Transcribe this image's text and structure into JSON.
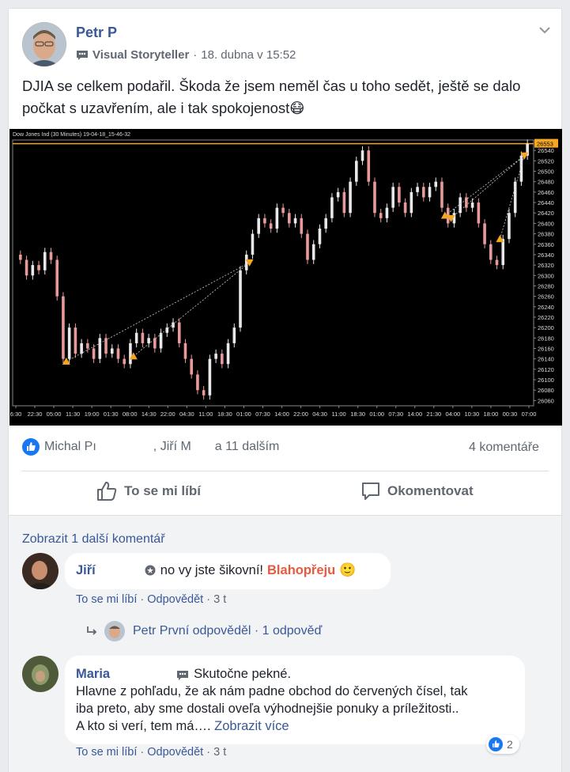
{
  "post": {
    "author": "Petr P",
    "subtitle_role": "Visual Storyteller",
    "subtitle_sep": "·",
    "time": "18. dubna v 15:52",
    "text": "DJIA se celkem podařil. Škoda že jsem neměl čas u toho sedět, ještě se dalo počkat s uzavřením, ale i tak spokojenost😷"
  },
  "chart_data": {
    "type": "candlestick",
    "title": "Dow Jones Ind (30 Minutes) 19-04-18_15-46-32",
    "last_price_label": "26553",
    "y_ticks": [
      "26540",
      "26520",
      "26500",
      "26480",
      "26460",
      "26440",
      "26420",
      "26400",
      "26380",
      "26360",
      "26340",
      "26320",
      "26300",
      "26280",
      "26260",
      "26240",
      "26220",
      "26200",
      "26180",
      "26160",
      "26140",
      "26120",
      "26100",
      "26080",
      "26060"
    ],
    "x_ticks": [
      "6:30",
      "22:30",
      "05:00",
      "11:30",
      "19:00",
      "01:30",
      "08:00",
      "14:30",
      "22:00",
      "04:30",
      "11:00",
      "18:30",
      "01:00",
      "07:30",
      "14:00",
      "22:00",
      "04:30",
      "11:00",
      "18:30",
      "01:00",
      "07:30",
      "14:00",
      "21:30",
      "04:00",
      "10:30",
      "18:00",
      "00:30",
      "07:00"
    ],
    "ylim": [
      26050,
      26560
    ],
    "price_path": [
      26340,
      26330,
      26300,
      26320,
      26310,
      26345,
      26330,
      26260,
      26140,
      26200,
      26150,
      26170,
      26160,
      26140,
      26180,
      26150,
      26160,
      26140,
      26130,
      26170,
      26190,
      26170,
      26180,
      26160,
      26190,
      26200,
      26210,
      26170,
      26140,
      26110,
      26080,
      26070,
      26140,
      26150,
      26130,
      26170,
      26200,
      26310,
      26340,
      26380,
      26410,
      26400,
      26390,
      26430,
      26420,
      26400,
      26410,
      26380,
      26330,
      26360,
      26390,
      26410,
      26450,
      26460,
      26420,
      26480,
      26520,
      26540,
      26480,
      26420,
      26410,
      26430,
      26470,
      26440,
      26420,
      26460,
      26470,
      26450,
      26470,
      26480,
      26430,
      26400,
      26420,
      26450,
      26430,
      26440,
      26400,
      26360,
      26330,
      26320,
      26370,
      26420,
      26480,
      26530,
      26553
    ],
    "trade_markers": [
      {
        "i": 8,
        "price": 26135,
        "dir": "buy"
      },
      {
        "i": 19,
        "price": 26145,
        "dir": "buy"
      },
      {
        "i": 38,
        "price": 26325,
        "dir": "sell"
      },
      {
        "i": 70,
        "price": 26415,
        "dir": "buy"
      },
      {
        "i": 71,
        "price": 26410,
        "dir": "sell"
      },
      {
        "i": 79,
        "price": 26370,
        "dir": "buy"
      },
      {
        "i": 83,
        "price": 26530,
        "dir": "sell"
      }
    ],
    "colors": {
      "up": "#e8e8e8",
      "down": "#e89a9a",
      "marker": "#f5a623",
      "price_line": "#f5a623"
    }
  },
  "reactions": {
    "names_a": "Michal Pı",
    "names_b": ", Jiří M",
    "names_c": "a 11 dalším",
    "comments_count": "4 komentáře"
  },
  "actions": {
    "like": "To se mi líbí",
    "comment": "Okomentovat"
  },
  "comments": {
    "more": "Zobrazit 1 další komentář",
    "c1": {
      "author": "Jiří",
      "text": "no vy jste šikovní!",
      "highlight": "Blahopřeju",
      "emoji": "🙂",
      "like": "To se mi líbí",
      "reply": "Odpovědět",
      "time": "3 t",
      "reply_summary": "Petr První odpověděl · 1 odpověď"
    },
    "c2": {
      "author": "Maria",
      "line1": "Skutočne pekné.",
      "line2": "Hlavne z pohľadu, že ak nám padne obchod do červených čísel, tak",
      "line3": "iba preto, aby sme dostali oveľa výhodnejšie ponuky a príležitosti..",
      "line4": "A kto si verí, tem má….",
      "see_more": "Zobrazit více",
      "like": "To se mi líbí",
      "reply": "Odpovědět",
      "time": "3 t",
      "likes": "2"
    },
    "sep": "·"
  }
}
